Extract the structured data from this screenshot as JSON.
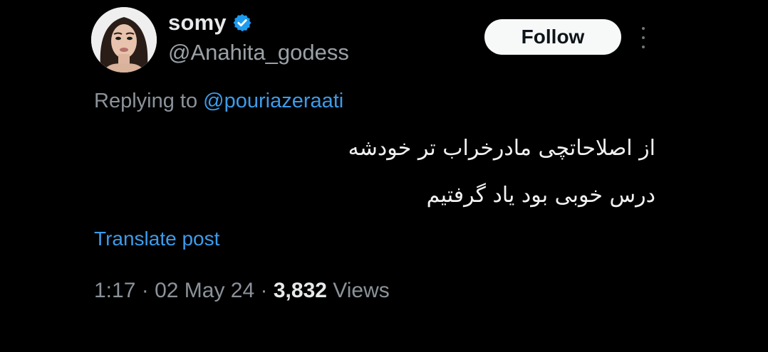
{
  "post": {
    "author": {
      "display_name": "somy",
      "handle": "@Anahita_godess",
      "verified": true,
      "verified_color": "#1d9bf0"
    },
    "follow_label": "Follow",
    "more_icon": "more-vertical-icon",
    "replying_prefix": "Replying to",
    "replying_to": "@pouriazeraati",
    "text_lines": [
      "از اصلاحاتچی مادرخراب تر خودشه",
      "درس خوبی بود یاد گرفتیم"
    ],
    "translate_label": "Translate post",
    "time": "1:17",
    "date": "02 May 24",
    "separator": "·",
    "views_count": "3,832",
    "views_label": "Views"
  },
  "colors": {
    "background": "#000000",
    "link": "#3d9be9",
    "secondary_text": "#8b9299",
    "primary_text": "#e7e9ea",
    "button_bg": "#f7f9f9"
  }
}
